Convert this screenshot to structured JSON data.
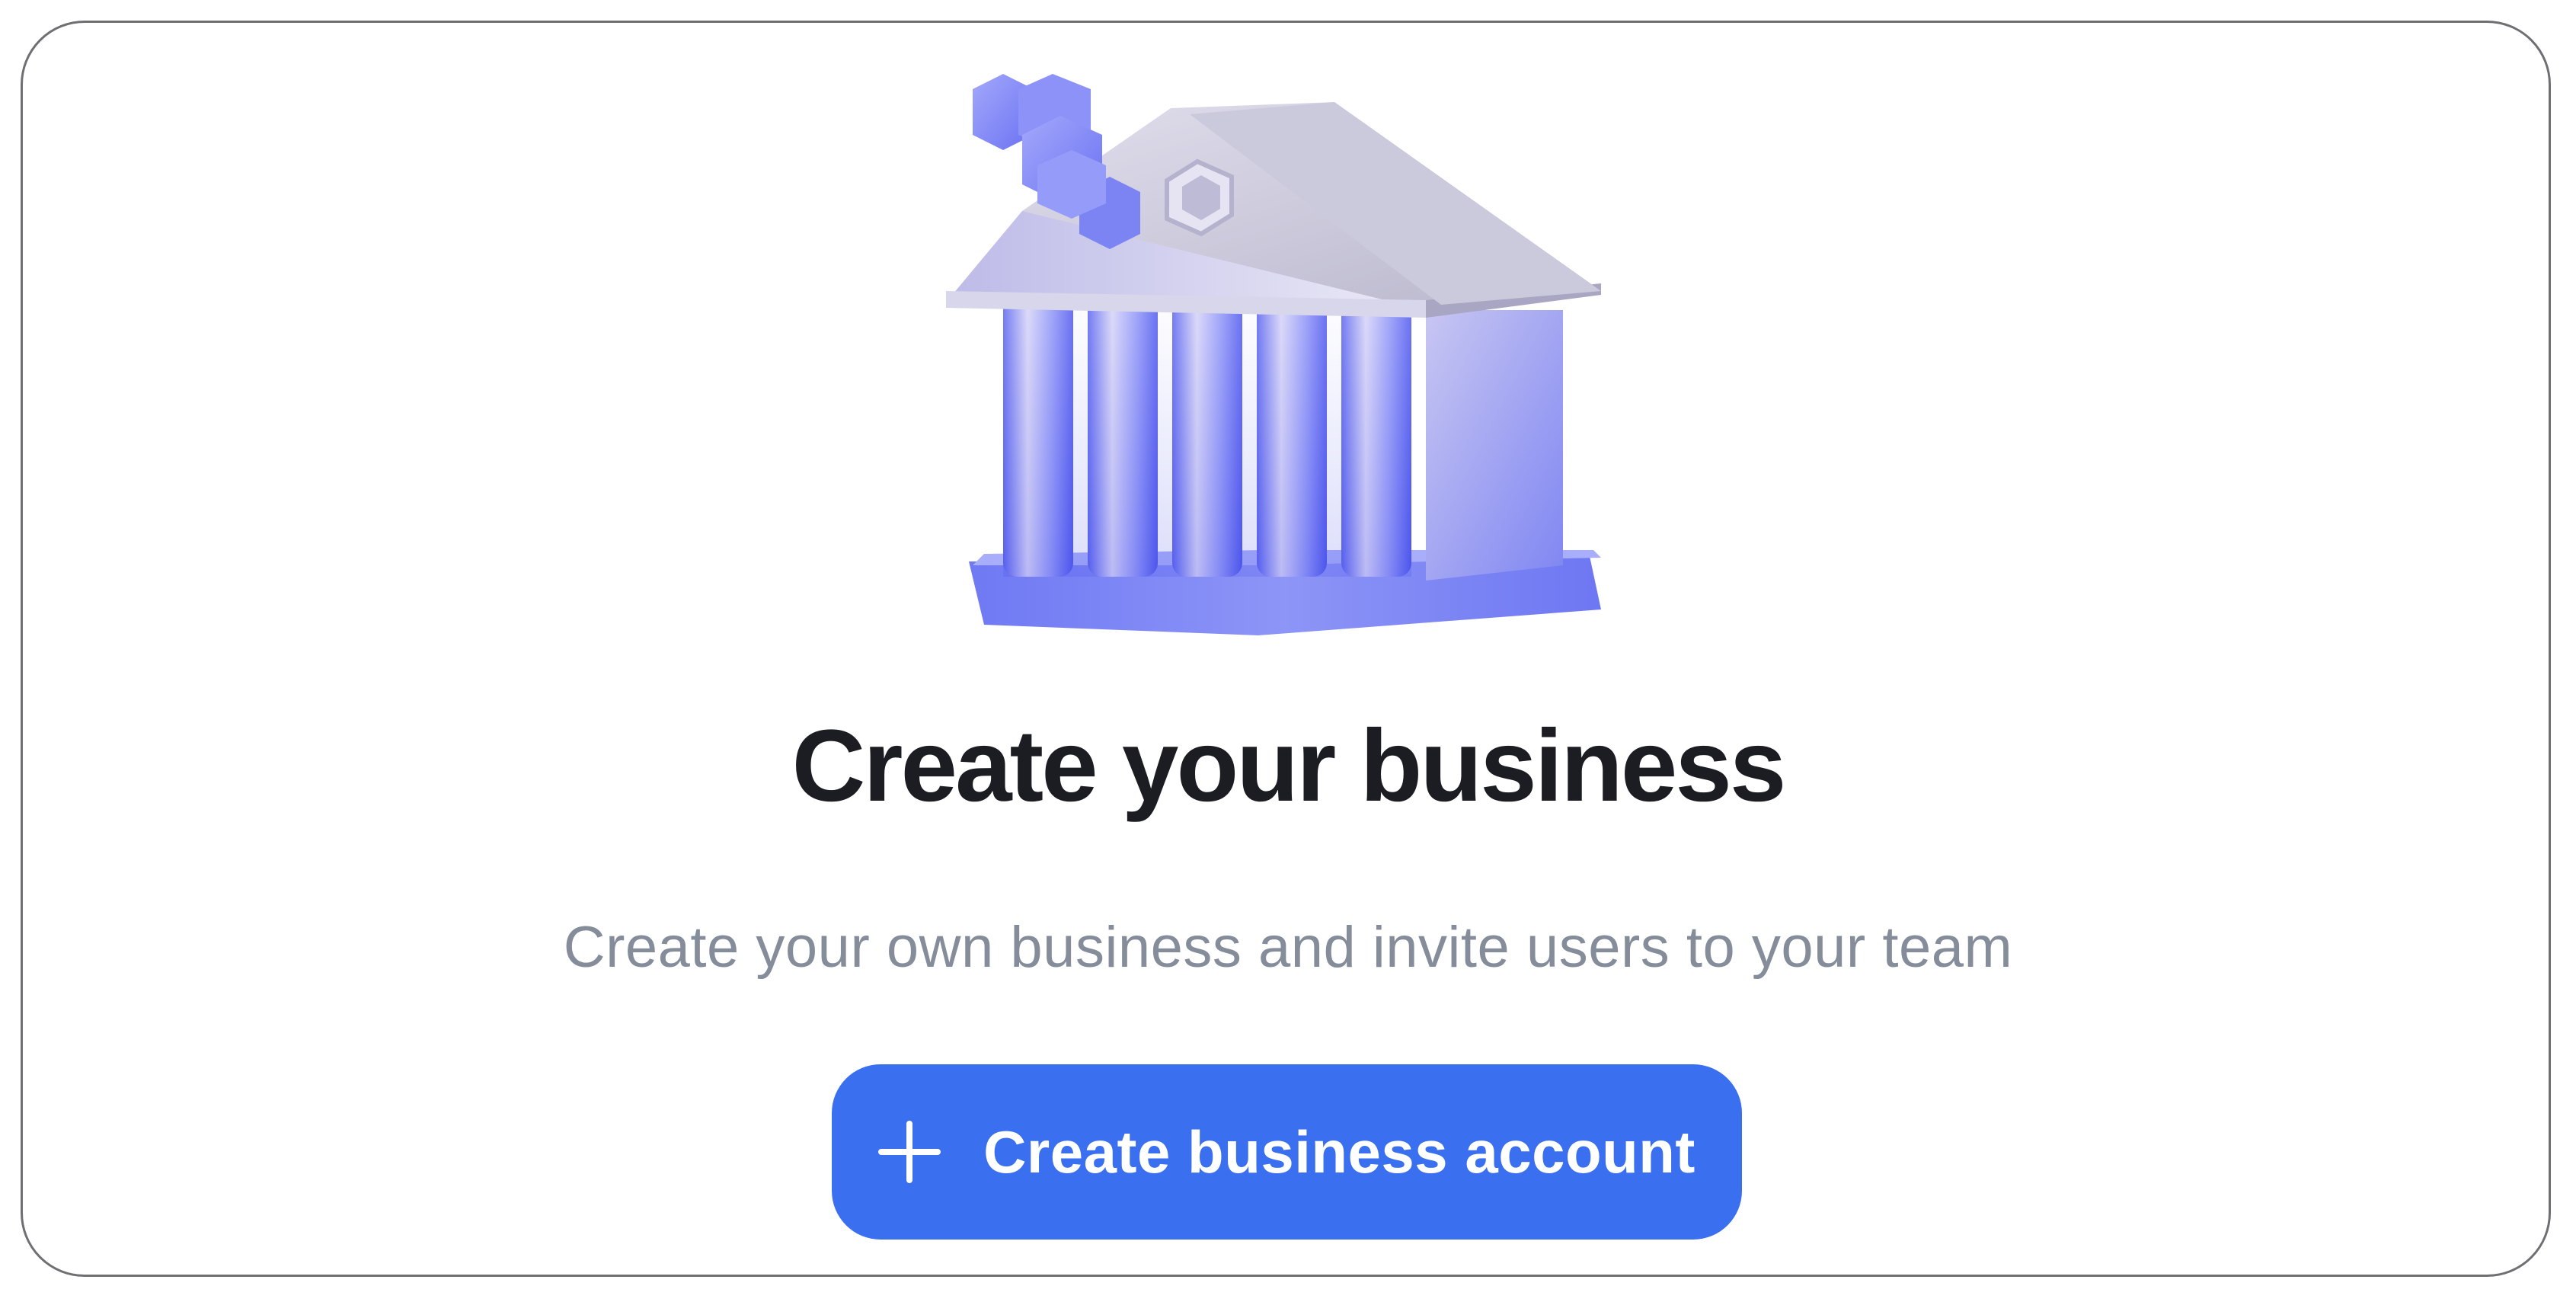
{
  "card": {
    "title": "Create your business",
    "subtitle": "Create your own business and invite users to your team",
    "cta": {
      "label": "Create business account",
      "icon": "plus-icon"
    },
    "illustration": "bank-building-illustration"
  },
  "colors": {
    "accent": "#3a6ff0",
    "title": "#1b1d22",
    "subtitle": "#858c9a",
    "border": "#6f6f73",
    "illustration_primary": "#7e86f5",
    "illustration_roof": "#c9c8d9"
  }
}
